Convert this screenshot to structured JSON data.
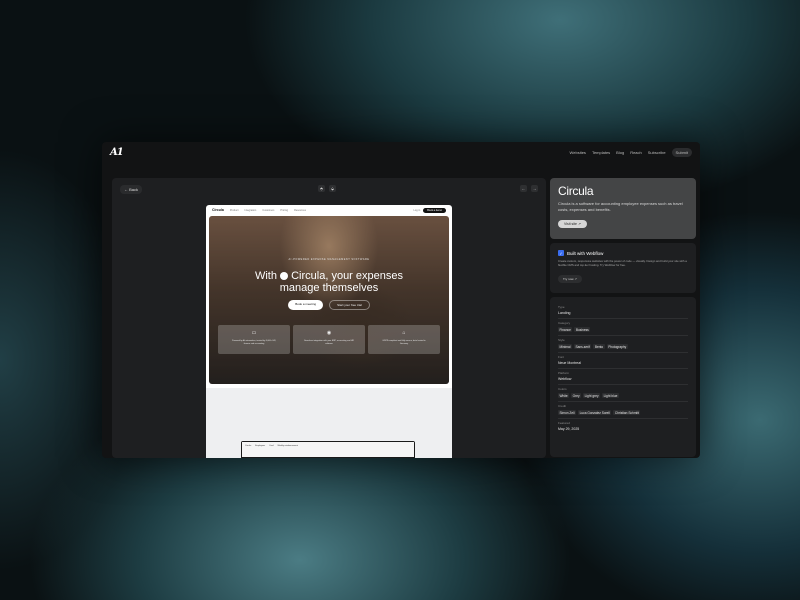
{
  "app": {
    "logo": "A1"
  },
  "topnav": {
    "items": [
      "Websites",
      "Templates",
      "Blog",
      "Reach",
      "Subscribe"
    ],
    "submit_label": "Submit"
  },
  "toolbar": {
    "back_label": "← Back",
    "prev": "←",
    "next": "→",
    "ctrl_a": "⬘",
    "ctrl_b": "⬙"
  },
  "preview": {
    "nav": {
      "brand": "Circula",
      "links": [
        "Product",
        "Integration",
        "Customers",
        "Pricing",
        "Resources"
      ],
      "login": "Log in",
      "demo": "Book a demo"
    },
    "hero": {
      "eyebrow": "AI-POWERED EXPENSE MANAGEMENT SOFTWARE",
      "headline_1": "With",
      "headline_2": "Circula, your expenses",
      "headline_3": "manage themselves",
      "btn_primary": "Book a meeting",
      "btn_secondary": "Start your free trial",
      "cards": [
        {
          "icon": "▭",
          "text": "Powered by AI automation, trusted by 3,000+ HR, finance and accounting"
        },
        {
          "icon": "◉",
          "text": "Seamless integration with your ERP, accounting and HR software"
        },
        {
          "icon": "⌂",
          "text": "GDPR-compliant and fully secure, data hosted in Germany"
        }
      ]
    },
    "laptop": {
      "brand": "Circula",
      "col_a": "Employees",
      "col_b": "Card",
      "col_c": "Weekly reimbursement"
    }
  },
  "sidebar": {
    "title": "Circula",
    "description": "Circula is a software for accounting employee expenses such as travel costs, expenses and benefits.",
    "visit_label": "Visit site ↗",
    "webflow": {
      "check": "✓",
      "title": "Built with Webflow",
      "description": "Create custom, responsive websites with the power of code — visually. Design and build your site with a flexible CMS and top-tier hosting. Try Webflow for free.",
      "try_label": "Try now ↗"
    },
    "details": [
      {
        "label": "Type",
        "values": [
          "Landing"
        ]
      },
      {
        "label": "Category",
        "values": [
          "Finance",
          "Business"
        ]
      },
      {
        "label": "Style",
        "values": [
          "Minimal",
          "Sans-serif",
          "Bento",
          "Photography"
        ]
      },
      {
        "label": "Font",
        "values": [
          "Neue Montreal"
        ]
      },
      {
        "label": "Platform",
        "values": [
          "Webflow"
        ]
      },
      {
        "label": "Colors",
        "values": [
          "White",
          "Grey",
          "Light grey",
          "Light blue"
        ]
      },
      {
        "label": "Credit",
        "values": [
          "Simon Zell",
          "Luca Gonzalez Sorell",
          "Christian Schmitt"
        ]
      },
      {
        "label": "Featured",
        "values": [
          "May 29, 2025"
        ]
      }
    ]
  },
  "colors": {
    "page_bg": "#0a1113",
    "accent_teal": "#3f6f78",
    "card_bg": "#1e1f21",
    "webflow_blue": "#3a6df0"
  }
}
